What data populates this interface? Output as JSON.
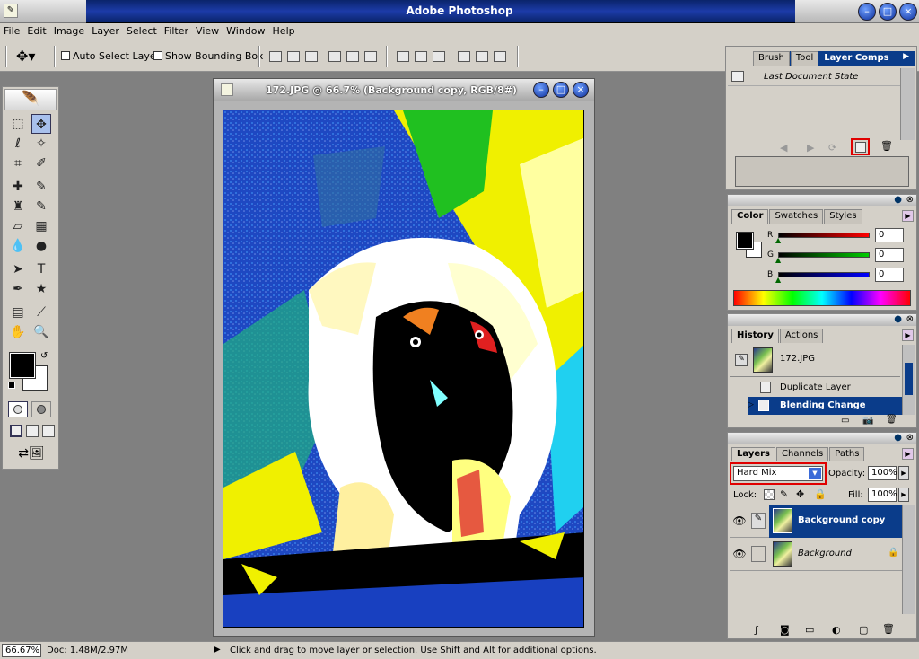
{
  "app": {
    "title": "Adobe Photoshop"
  },
  "menu": [
    "File",
    "Edit",
    "Image",
    "Layer",
    "Select",
    "Filter",
    "View",
    "Window",
    "Help"
  ],
  "options": {
    "auto_select": "Auto Select Layer",
    "show_bounding": "Show Bounding Box"
  },
  "document": {
    "title": "172.JPG @ 66.7% (Background copy, RGB/8#)"
  },
  "layer_comps": {
    "tabs": [
      "Brush",
      "Tool",
      "Layer Comps"
    ],
    "item": "Last Document State"
  },
  "color_panel": {
    "tabs": [
      "Color",
      "Swatches",
      "Styles"
    ],
    "r_label": "R",
    "g_label": "G",
    "b_label": "B",
    "r": "0",
    "g": "0",
    "b": "0"
  },
  "history": {
    "tabs": [
      "History",
      "Actions"
    ],
    "snapshot": "172.JPG",
    "items": [
      "Duplicate Layer",
      "Blending Change"
    ]
  },
  "layers": {
    "tabs": [
      "Layers",
      "Channels",
      "Paths"
    ],
    "blend_mode": "Hard Mix",
    "opacity_label": "Opacity:",
    "opacity": "100%",
    "lock_label": "Lock:",
    "fill_label": "Fill:",
    "fill": "100%",
    "items": [
      "Background copy",
      "Background"
    ]
  },
  "status": {
    "zoom": "66.67%",
    "doc": "Doc: 1.48M/2.97M",
    "hint": "Click and drag to move layer or selection.  Use Shift and Alt for additional options."
  },
  "colors": {
    "title_blue": "#0a246a",
    "selection": "#0a3c8a",
    "highlight": "#e00000"
  }
}
